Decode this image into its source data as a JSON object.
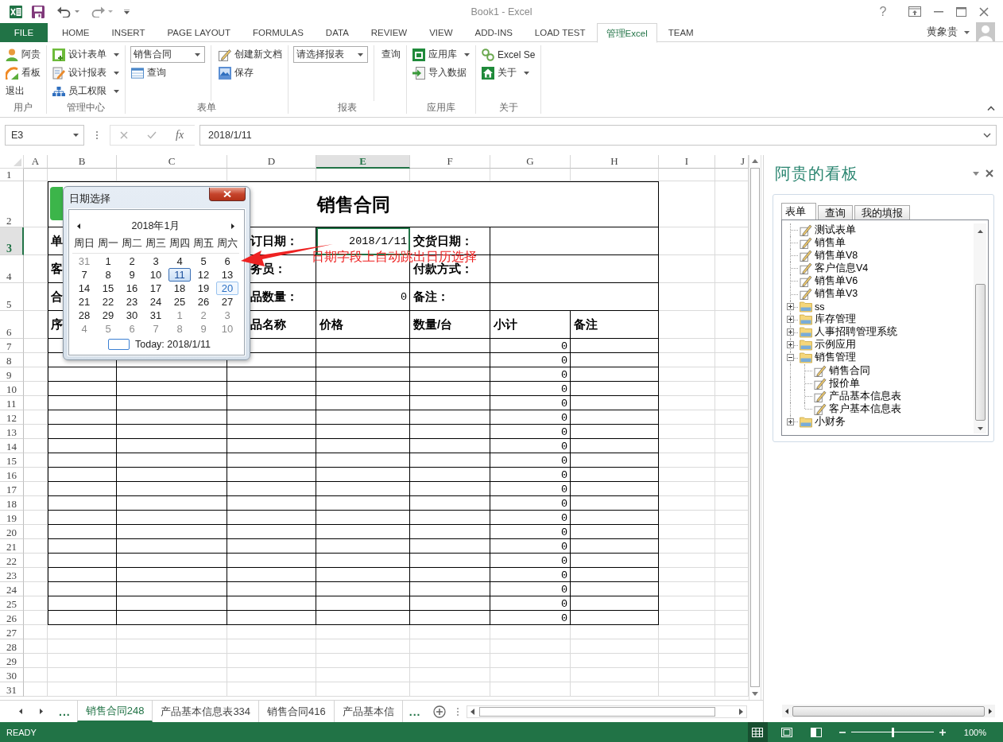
{
  "window": {
    "title": "Book1 - Excel",
    "help": "?"
  },
  "ribbon": {
    "tabs": [
      {
        "label": "FILE",
        "kind": "file",
        "selected": false
      },
      {
        "label": "HOME",
        "kind": "tab",
        "selected": false
      },
      {
        "label": "INSERT",
        "kind": "tab",
        "selected": false
      },
      {
        "label": "PAGE LAYOUT",
        "kind": "tab",
        "selected": false
      },
      {
        "label": "FORMULAS",
        "kind": "tab",
        "selected": false
      },
      {
        "label": "DATA",
        "kind": "tab",
        "selected": false
      },
      {
        "label": "REVIEW",
        "kind": "tab",
        "selected": false
      },
      {
        "label": "VIEW",
        "kind": "tab",
        "selected": false
      },
      {
        "label": "ADD-INS",
        "kind": "tab",
        "selected": false
      },
      {
        "label": "LOAD TEST",
        "kind": "tab",
        "selected": false
      },
      {
        "label": "管理Excel",
        "kind": "tab",
        "selected": true
      },
      {
        "label": "TEAM",
        "kind": "tab",
        "selected": false
      }
    ],
    "user": "黄象贵",
    "groups": [
      {
        "label": "用户",
        "columns": [
          [
            {
              "kind": "button",
              "label": "阿贵",
              "dropdown": false
            },
            {
              "kind": "button",
              "label": "看板",
              "dropdown": false
            },
            {
              "kind": "text",
              "label": "退出",
              "dropdown": false
            }
          ]
        ]
      },
      {
        "label": "管理中心",
        "columns": [
          [
            {
              "kind": "button",
              "label": "设计表单",
              "dropdown": true
            },
            {
              "kind": "button",
              "label": "设计报表",
              "dropdown": true
            },
            {
              "kind": "button",
              "label": "员工权限",
              "dropdown": true
            }
          ]
        ]
      },
      {
        "label": "表单",
        "columns": [
          [
            {
              "kind": "combo",
              "value": "销售合同"
            },
            {
              "kind": "button",
              "label": "查询",
              "dropdown": false
            }
          ],
          [
            {
              "kind": "button",
              "label": "创建新文档",
              "dropdown": false
            },
            {
              "kind": "button",
              "label": "保存",
              "dropdown": false
            }
          ]
        ]
      },
      {
        "label": "报表",
        "columns": [
          [
            {
              "kind": "combo",
              "value": "请选择报表"
            }
          ],
          [
            {
              "kind": "text",
              "label": "查询",
              "dropdown": false
            }
          ]
        ]
      },
      {
        "label": "应用库",
        "columns": [
          [
            {
              "kind": "button",
              "label": "应用库",
              "dropdown": true
            },
            {
              "kind": "button",
              "label": "导入数据",
              "dropdown": false
            }
          ]
        ]
      },
      {
        "label": "关于",
        "columns": [
          [
            {
              "kind": "button",
              "label": "Excel Se",
              "dropdown": false
            },
            {
              "kind": "button",
              "label": "关于",
              "dropdown": true
            }
          ]
        ]
      }
    ]
  },
  "formula_bar": {
    "name_box": "E3",
    "function_label": "fx",
    "value": "2018/1/11"
  },
  "sheet": {
    "columns": [
      {
        "label": "A",
        "selected": false
      },
      {
        "label": "B",
        "selected": false
      },
      {
        "label": "C",
        "selected": false
      },
      {
        "label": "D",
        "selected": false
      },
      {
        "label": "E",
        "selected": true
      },
      {
        "label": "F",
        "selected": false
      },
      {
        "label": "G",
        "selected": false
      },
      {
        "label": "H",
        "selected": false
      },
      {
        "label": "I",
        "selected": false
      },
      {
        "label": "J",
        "selected": false
      }
    ],
    "rows": [
      {
        "label": "1",
        "selected": false
      },
      {
        "label": "2",
        "selected": false
      },
      {
        "label": "3",
        "selected": true
      },
      {
        "label": "4",
        "selected": false
      },
      {
        "label": "5",
        "selected": false
      },
      {
        "label": "6",
        "selected": false
      },
      {
        "label": "7",
        "selected": false
      },
      {
        "label": "8",
        "selected": false
      },
      {
        "label": "9",
        "selected": false
      },
      {
        "label": "10",
        "selected": false
      },
      {
        "label": "11",
        "selected": false
      },
      {
        "label": "12",
        "selected": false
      },
      {
        "label": "13",
        "selected": false
      },
      {
        "label": "14",
        "selected": false
      },
      {
        "label": "15",
        "selected": false
      },
      {
        "label": "16",
        "selected": false
      },
      {
        "label": "17",
        "selected": false
      },
      {
        "label": "18",
        "selected": false
      },
      {
        "label": "19",
        "selected": false
      },
      {
        "label": "20",
        "selected": false
      },
      {
        "label": "21",
        "selected": false
      },
      {
        "label": "22",
        "selected": false
      },
      {
        "label": "23",
        "selected": false
      },
      {
        "label": "24",
        "selected": false
      },
      {
        "label": "25",
        "selected": false
      },
      {
        "label": "26",
        "selected": false
      },
      {
        "label": "27",
        "selected": false
      },
      {
        "label": "28",
        "selected": false
      },
      {
        "label": "29",
        "selected": false
      },
      {
        "label": "30",
        "selected": false
      },
      {
        "label": "31",
        "selected": false
      }
    ],
    "form": {
      "title": "销售合同",
      "info_rows": [
        [
          {
            "text": "单",
            "kind": "label",
            "selected": false
          },
          {
            "text": "订日期：",
            "kind": "label",
            "selected": false
          },
          {
            "text": "2018/1/11",
            "kind": "value",
            "selected": true
          },
          {
            "text": "交货日期：",
            "kind": "label",
            "selected": false
          },
          {
            "kind": "value",
            "selected": false
          }
        ],
        [
          {
            "text": "客",
            "kind": "label",
            "selected": false
          },
          {
            "text": "务员：",
            "kind": "label",
            "selected": false
          },
          {
            "kind": "value",
            "selected": false
          },
          {
            "text": "付款方式：",
            "kind": "label",
            "selected": false
          },
          {
            "kind": "value",
            "selected": false
          }
        ],
        [
          {
            "text": "合",
            "kind": "label",
            "selected": false
          },
          {
            "text": "品数量：",
            "kind": "label",
            "selected": false
          },
          {
            "text": "0",
            "kind": "value",
            "selected": false
          },
          {
            "text": "备注：",
            "kind": "label",
            "selected": false
          },
          {
            "kind": "value",
            "selected": false
          }
        ]
      ],
      "header_row": [
        {
          "text": "序",
          "selected": false
        },
        {
          "text": "品名称",
          "selected": false
        },
        {
          "text": "价格",
          "selected": false
        },
        {
          "text": "数量/台",
          "selected": false
        },
        {
          "text": "小计",
          "selected": false
        },
        {
          "text": "备注",
          "selected": false
        }
      ],
      "item_rows": [
        {
          "subtotal": "0"
        },
        {
          "subtotal": "0"
        },
        {
          "subtotal": "0"
        },
        {
          "subtotal": "0"
        },
        {
          "subtotal": "0"
        },
        {
          "subtotal": "0"
        },
        {
          "subtotal": "0"
        },
        {
          "subtotal": "0"
        },
        {
          "subtotal": "0"
        },
        {
          "subtotal": "0"
        },
        {
          "subtotal": "0"
        },
        {
          "subtotal": "0"
        },
        {
          "subtotal": "0"
        },
        {
          "subtotal": "0"
        },
        {
          "subtotal": "0"
        },
        {
          "subtotal": "0"
        },
        {
          "subtotal": "0"
        },
        {
          "subtotal": "0"
        },
        {
          "subtotal": "0"
        },
        {
          "subtotal": "0"
        }
      ]
    }
  },
  "date_picker": {
    "title": "日期选择",
    "month": "2018年1月",
    "weekdays": [
      "周日",
      "周一",
      "周二",
      "周三",
      "周四",
      "周五",
      "周六"
    ],
    "weeks": [
      [
        {
          "day": "31",
          "other_month": true,
          "selected": false,
          "hovered": false
        },
        {
          "day": "1",
          "other_month": false,
          "selected": false,
          "hovered": false
        },
        {
          "day": "2",
          "other_month": false,
          "selected": false,
          "hovered": false
        },
        {
          "day": "3",
          "other_month": false,
          "selected": false,
          "hovered": false
        },
        {
          "day": "4",
          "other_month": false,
          "selected": false,
          "hovered": false
        },
        {
          "day": "5",
          "other_month": false,
          "selected": false,
          "hovered": false
        },
        {
          "day": "6",
          "other_month": false,
          "selected": false,
          "hovered": false
        }
      ],
      [
        {
          "day": "7",
          "other_month": false,
          "selected": false,
          "hovered": false
        },
        {
          "day": "8",
          "other_month": false,
          "selected": false,
          "hovered": false
        },
        {
          "day": "9",
          "other_month": false,
          "selected": false,
          "hovered": false
        },
        {
          "day": "10",
          "other_month": false,
          "selected": false,
          "hovered": false
        },
        {
          "day": "11",
          "other_month": false,
          "selected": true,
          "hovered": false
        },
        {
          "day": "12",
          "other_month": false,
          "selected": false,
          "hovered": false
        },
        {
          "day": "13",
          "other_month": false,
          "selected": false,
          "hovered": false
        }
      ],
      [
        {
          "day": "14",
          "other_month": false,
          "selected": false,
          "hovered": false
        },
        {
          "day": "15",
          "other_month": false,
          "selected": false,
          "hovered": false
        },
        {
          "day": "16",
          "other_month": false,
          "selected": false,
          "hovered": false
        },
        {
          "day": "17",
          "other_month": false,
          "selected": false,
          "hovered": false
        },
        {
          "day": "18",
          "other_month": false,
          "selected": false,
          "hovered": false
        },
        {
          "day": "19",
          "other_month": false,
          "selected": false,
          "hovered": false
        },
        {
          "day": "20",
          "other_month": false,
          "selected": false,
          "hovered": true
        }
      ],
      [
        {
          "day": "21",
          "other_month": false,
          "selected": false,
          "hovered": false
        },
        {
          "day": "22",
          "other_month": false,
          "selected": false,
          "hovered": false
        },
        {
          "day": "23",
          "other_month": false,
          "selected": false,
          "hovered": false
        },
        {
          "day": "24",
          "other_month": false,
          "selected": false,
          "hovered": false
        },
        {
          "day": "25",
          "other_month": false,
          "selected": false,
          "hovered": false
        },
        {
          "day": "26",
          "other_month": false,
          "selected": false,
          "hovered": false
        },
        {
          "day": "27",
          "other_month": false,
          "selected": false,
          "hovered": false
        }
      ],
      [
        {
          "day": "28",
          "other_month": false,
          "selected": false,
          "hovered": false
        },
        {
          "day": "29",
          "other_month": false,
          "selected": false,
          "hovered": false
        },
        {
          "day": "30",
          "other_month": false,
          "selected": false,
          "hovered": false
        },
        {
          "day": "31",
          "other_month": false,
          "selected": false,
          "hovered": false
        },
        {
          "day": "1",
          "other_month": true,
          "selected": false,
          "hovered": false
        },
        {
          "day": "2",
          "other_month": true,
          "selected": false,
          "hovered": false
        },
        {
          "day": "3",
          "other_month": true,
          "selected": false,
          "hovered": false
        }
      ],
      [
        {
          "day": "4",
          "other_month": true,
          "selected": false,
          "hovered": false
        },
        {
          "day": "5",
          "other_month": true,
          "selected": false,
          "hovered": false
        },
        {
          "day": "6",
          "other_month": true,
          "selected": false,
          "hovered": false
        },
        {
          "day": "7",
          "other_month": true,
          "selected": false,
          "hovered": false
        },
        {
          "day": "8",
          "other_month": true,
          "selected": false,
          "hovered": false
        },
        {
          "day": "9",
          "other_month": true,
          "selected": false,
          "hovered": false
        },
        {
          "day": "10",
          "other_month": true,
          "selected": false,
          "hovered": false
        }
      ]
    ],
    "today": "Today: 2018/1/11"
  },
  "annotation": {
    "text": "日期字段上自动跳出日历选择"
  },
  "sheet_tabs": {
    "overflow_left": "...",
    "tabs": [
      {
        "label": "销售合同248",
        "selected": true
      },
      {
        "label": "产品基本信息表334",
        "selected": false
      },
      {
        "label": "销售合同416",
        "selected": false
      },
      {
        "label": "产品基本信",
        "selected": false
      }
    ],
    "overflow_right": "..."
  },
  "task_pane": {
    "title": "阿贵的看板",
    "tabs": [
      {
        "label": "表单",
        "selected": true
      },
      {
        "label": "查询",
        "selected": false
      },
      {
        "label": "我的填报",
        "selected": false
      }
    ],
    "tree": [
      {
        "label": "测试表单",
        "kind": "form"
      },
      {
        "label": "销售单",
        "kind": "form"
      },
      {
        "label": "销售单V8",
        "kind": "form"
      },
      {
        "label": "客户信息V4",
        "kind": "form"
      },
      {
        "label": "销售单V6",
        "kind": "form"
      },
      {
        "label": "销售单V3",
        "kind": "form"
      },
      {
        "label": "ss",
        "kind": "folder",
        "expanded": false
      },
      {
        "label": "库存管理",
        "kind": "folder",
        "expanded": false
      },
      {
        "label": "人事招聘管理系统",
        "kind": "folder",
        "expanded": false
      },
      {
        "label": "示例应用",
        "kind": "folder",
        "expanded": false
      },
      {
        "label": "销售管理",
        "kind": "folder",
        "expanded": true,
        "children": [
          {
            "label": "销售合同",
            "kind": "form"
          },
          {
            "label": "报价单",
            "kind": "form"
          },
          {
            "label": "产品基本信息表",
            "kind": "form"
          },
          {
            "label": "客户基本信息表",
            "kind": "form"
          }
        ]
      },
      {
        "label": "小财务",
        "kind": "folder",
        "expanded": false
      }
    ]
  },
  "status_bar": {
    "status": "READY",
    "views": [
      {
        "selected": true
      },
      {
        "selected": false
      },
      {
        "selected": false
      }
    ],
    "zoom": {
      "level": 0.5,
      "reading": "100%"
    }
  }
}
